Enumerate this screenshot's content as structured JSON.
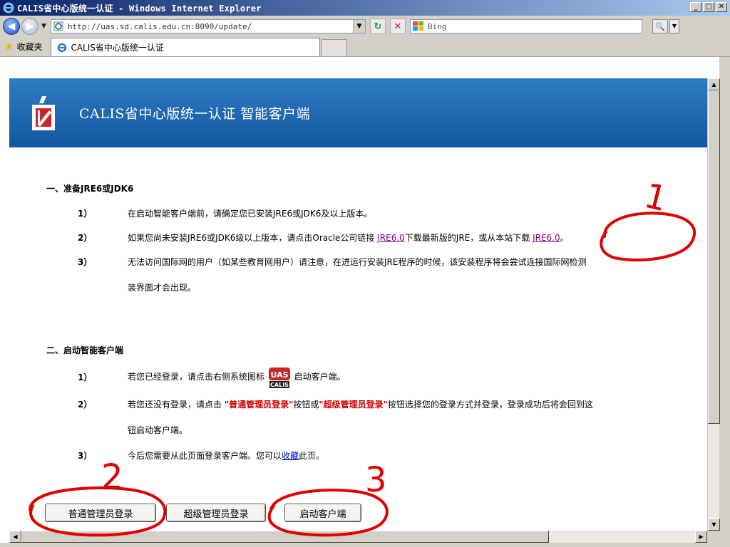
{
  "window": {
    "title": "CALIS省中心版统一认证 - Windows Internet Explorer",
    "controls": [
      "_",
      "□",
      "✕"
    ]
  },
  "navbar": {
    "address_value": "http://uas.sd.calis.edu.cn:8090/update/",
    "search_placeholder": "Bing",
    "refresh_icon": "refresh-icon",
    "stop_icon": "stop-icon"
  },
  "favorites": {
    "label": "收藏夹",
    "tab_title": "CALIS省中心版统一认证"
  },
  "page": {
    "banner_title": "CALIS省中心版统一认证 智能客户端",
    "section1": {
      "title": "一、准备JRE6或JDK6",
      "steps": [
        {
          "num": "1）",
          "text": "在启动智能客户端前，请确定您已安装JRE6或JDK6及以上版本。"
        },
        {
          "num": "2）",
          "text_a": "如果您尚未安装JRE6或JDK6级以上版本，请点击Oracle公司链接 ",
          "link1": "JRE6.0",
          "text_b": "下载最新版的JRE，或从本站下载 ",
          "link2": "JRE6.0",
          "text_c": "。"
        },
        {
          "num": "3）",
          "text": "无法访问国际网的用户（如某些教育网用户）请注意，在进运行安装JRE程序的时候，该安装程序将会尝试连接国际网检测",
          "text_cont": "装界面才会出现。"
        }
      ]
    },
    "section2": {
      "title": "二、启动智能客户端",
      "steps": [
        {
          "num": "1）",
          "text_a": "若您已经登录，请点击右侧系统图标 ",
          "icon_top": "UAS",
          "icon_bottom": "CALIS",
          "text_b": " 启动客户端。"
        },
        {
          "num": "2）",
          "text_a": "若您还没有登录，请点击 ",
          "red1": "\"普通管理员登录\"",
          "text_b": "按钮或",
          "red2": "\"超级管理员登录\"",
          "text_c": "按钮选择您的登录方式并登录，登录成功后将会回到这",
          "text_cont": "钮启动客户端。"
        },
        {
          "num": "3）",
          "text_a": "今后您需要从此页面登录客户端。您可以",
          "link": "收藏",
          "text_b": "此页。"
        }
      ]
    },
    "buttons": {
      "normal_admin": "普通管理员登录",
      "super_admin": "超级管理员登录",
      "start_client": "启动客户端"
    }
  },
  "annotations": {
    "mark1": "1",
    "mark2": "2",
    "mark3": "3",
    "color": "#e00000"
  },
  "colors": {
    "banner": "#1f6cb5",
    "link_visited": "#800080",
    "emphasis_red": "#d00000"
  }
}
